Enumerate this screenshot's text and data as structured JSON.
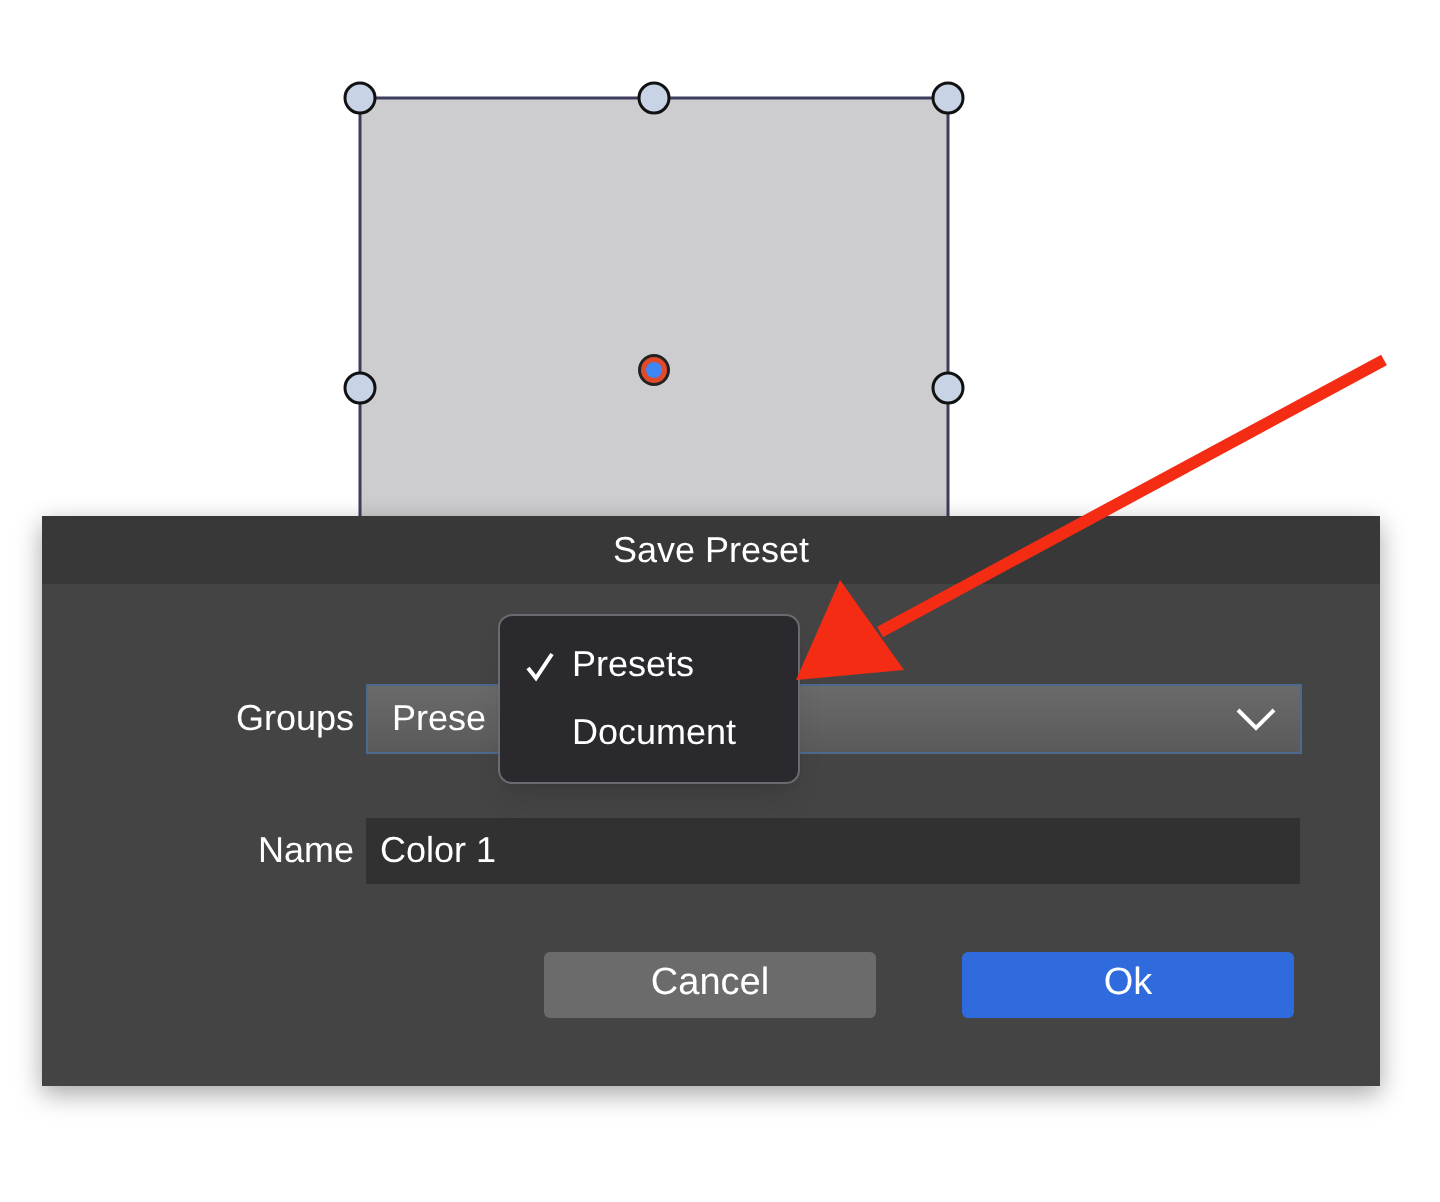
{
  "dialog": {
    "title": "Save Preset",
    "groups": {
      "label": "Groups",
      "value": "Prese"
    },
    "menu": [
      {
        "label": "Presets",
        "selected": true
      },
      {
        "label": "Document",
        "selected": false
      }
    ],
    "name": {
      "label": "Name",
      "value": "Color 1"
    },
    "buttons": [
      {
        "label": "Cancel",
        "kind": "secondary"
      },
      {
        "label": "Ok",
        "kind": "primary"
      }
    ]
  }
}
